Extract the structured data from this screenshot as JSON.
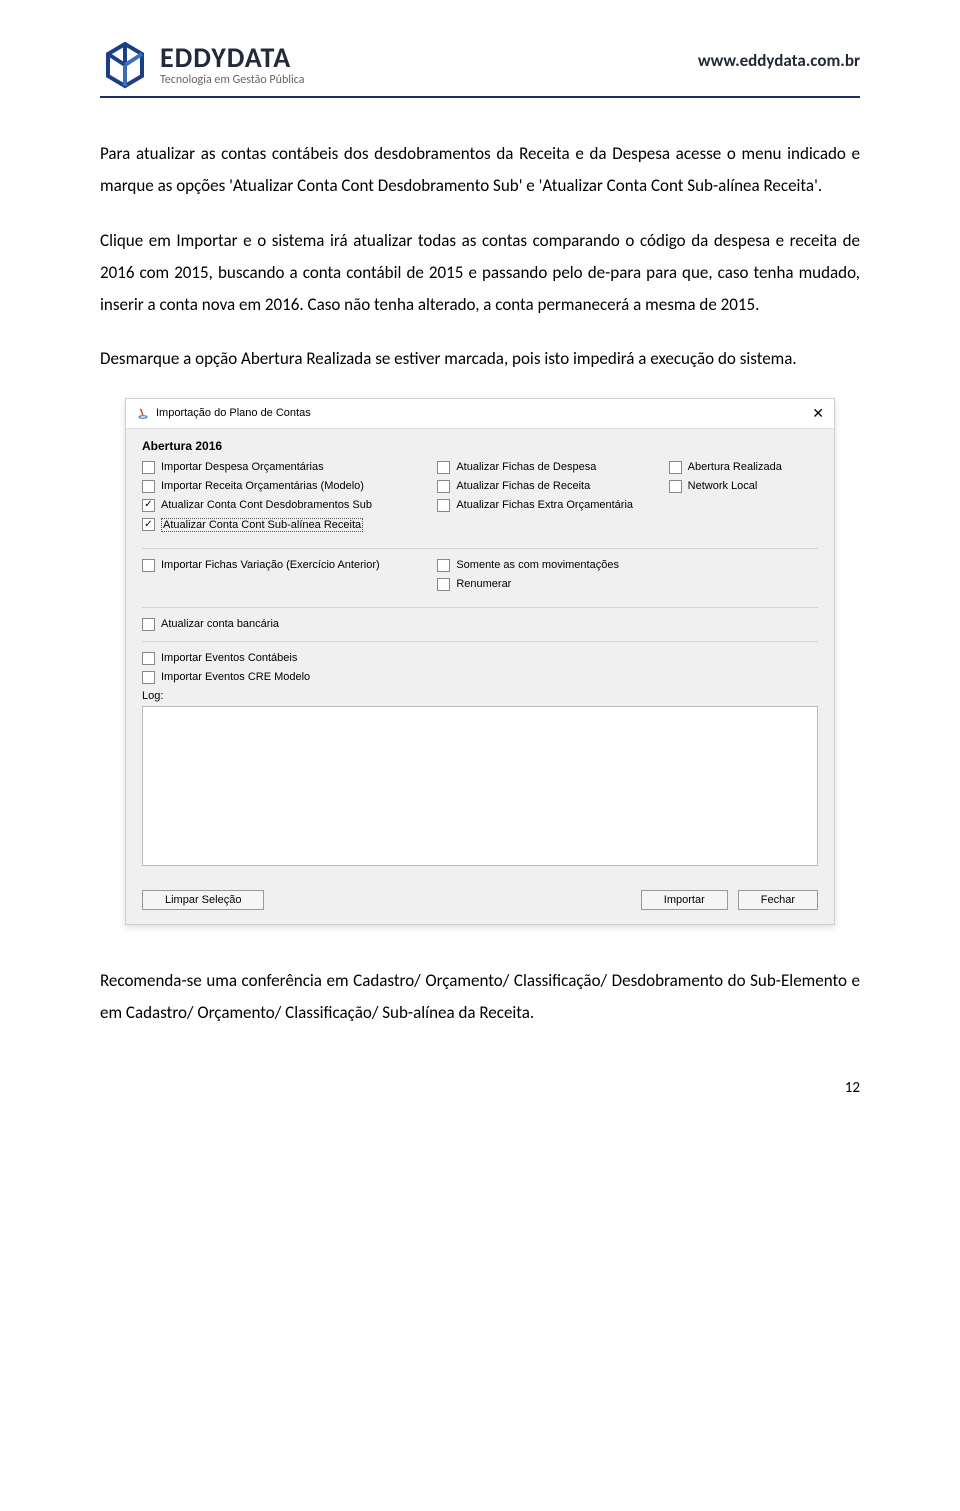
{
  "header": {
    "brand_name": "EDDYDATA",
    "brand_tag": "Tecnologia em Gestão Pública",
    "site_url": "www.eddydata.com.br"
  },
  "paragraphs": {
    "p1": "Para atualizar as contas contábeis dos desdobramentos da Receita e da Despesa acesse o menu indicado e marque as opções 'Atualizar Conta Cont Desdobramento Sub' e 'Atualizar Conta Cont Sub-alínea Receita'.",
    "p2": "Clique em Importar e o sistema irá atualizar todas as contas comparando o código da despesa e receita de 2016 com 2015, buscando a conta contábil de 2015 e passando pelo de-para para que, caso tenha mudado, inserir a conta nova em 2016. Caso não tenha alterado, a conta permanecerá a mesma de 2015.",
    "p3": "Desmarque a opção Abertura Realizada se estiver marcada, pois isto impedirá a execução do sistema.",
    "p4": "Recomenda-se uma conferência em Cadastro/ Orçamento/ Classificação/ Desdobramento do Sub-Elemento e em Cadastro/ Orçamento/ Classificação/ Sub-alínea da Receita."
  },
  "dialog": {
    "window_title": "Importação do Plano de Contas",
    "section_title": "Abertura 2016",
    "col1": {
      "c1": "Importar Despesa Orçamentárias",
      "c2": "Importar Receita Orçamentárias (Modelo)",
      "c3": "Atualizar Conta Cont Desdobramentos Sub",
      "c4": "Atualizar Conta Cont Sub-alínea Receita"
    },
    "col2": {
      "c1": "Atualizar Fichas de Despesa",
      "c2": "Atualizar Fichas de Receita",
      "c3": "Atualizar Fichas Extra Orçamentária"
    },
    "col3": {
      "c1": "Abertura Realizada",
      "c2": "Network Local"
    },
    "group2_col1": "Importar Fichas Variação (Exercício Anterior)",
    "group2_col2a": "Somente as com movimentações",
    "group2_col2b": "Renumerar",
    "group3": "Atualizar conta bancária",
    "group4a": "Importar Eventos Contábeis",
    "group4b": "Importar Eventos CRE Modelo",
    "log_label": "Log:",
    "btn_clear": "Limpar Seleção",
    "btn_import": "Importar",
    "btn_close": "Fechar"
  },
  "page_number": "12"
}
